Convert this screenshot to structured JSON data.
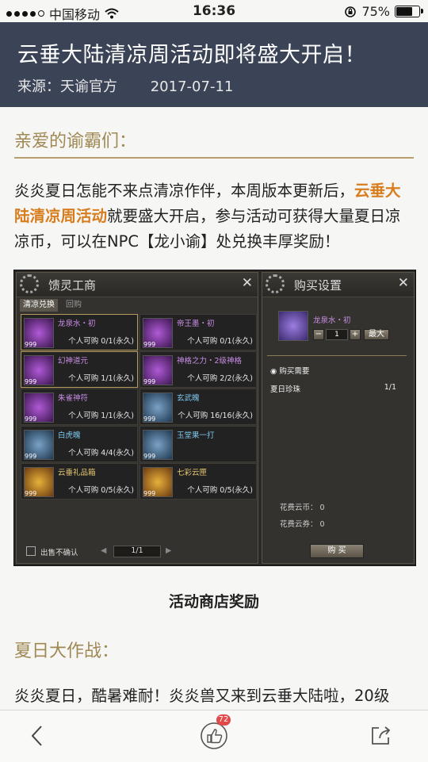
{
  "status": {
    "carrier": "中国移动",
    "time": "16:36",
    "battery": "75%",
    "battery_level": 0.75
  },
  "article": {
    "title": "云垂大陆清凉周活动即将盛大开启！",
    "source": "来源：天谕官方",
    "date": "2017-07-11"
  },
  "section1": {
    "heading": "亲爱的谕霸们：",
    "line1_a": "炎炎夏日怎能不来点清凉作伴，本周版本更新后，",
    "line1_hl": "云垂大",
    "line2_hl": "陆清凉周活动",
    "line2_b": "就要盛大开启，参与活动可获得大量夏日凉",
    "line3": "凉币，可以在NPC【龙小谕】处兑换丰厚奖励！"
  },
  "game": {
    "shop_title": "馈灵工商",
    "tab_active": "清凉兑换",
    "tab_other": "回购",
    "items": [
      {
        "name": "龙泉水・初",
        "qty": "999",
        "limit": "个人可购 0/1(永久)",
        "color": "purple",
        "icon": "dragon-water-icon"
      },
      {
        "name": "帝王墨・初",
        "qty": "999",
        "limit": "个人可购 0/1(永久)",
        "color": "purple",
        "icon": "emperor-ink-icon"
      },
      {
        "name": "幻神道元",
        "qty": "999",
        "limit": "个人可购 1/1(永久)",
        "color": "purple",
        "icon": "phantom-orb-icon"
      },
      {
        "name": "神格之力・2级神格",
        "qty": "999",
        "limit": "个人可购 2/2(永久)",
        "color": "purple",
        "icon": "divinity-gem-icon"
      },
      {
        "name": "朱雀神符",
        "qty": "999",
        "limit": "个人可购 1/1(永久)",
        "color": "purple",
        "icon": "phoenix-talisman-icon"
      },
      {
        "name": "玄武魄",
        "qty": "999",
        "limit": "个人可购 16/16(永久)",
        "color": "blue",
        "icon": "tortoise-soul-icon"
      },
      {
        "name": "白虎魄",
        "qty": "999",
        "limit": "个人可购 4/4(永久)",
        "color": "blue",
        "icon": "tiger-soul-icon"
      },
      {
        "name": "玉堂果一打",
        "qty": "999",
        "limit": "",
        "color": "blue",
        "icon": "jade-fruit-icon"
      },
      {
        "name": "云垂礼品箱",
        "qty": "999",
        "limit": "个人可购 0/5(永久)",
        "color": "yellow",
        "icon": "gift-box-icon"
      },
      {
        "name": "七彩云匣",
        "qty": "999",
        "limit": "个人可购 0/5(永久)",
        "color": "yellow",
        "icon": "treasure-chest-icon"
      }
    ],
    "checkbox_label": "出售不确认",
    "page": "1/1",
    "buy_title": "购买设置",
    "buy_item": "龙泉水・初",
    "buy_qty": "1",
    "buy_max": "最大",
    "need_label": "购买需要",
    "need_item": "夏日珍珠",
    "need_amount": "1/1",
    "cost_coin_label": "花费云币：",
    "cost_coin": "0",
    "cost_ticket_label": "花费云券：",
    "cost_ticket": "0",
    "buy_button": "购 买"
  },
  "caption": "活动商店奖励",
  "section2": {
    "heading": "夏日大作战：",
    "line1": "炎炎夏日，酷暑难耐！炎炎兽又来到云垂大陆啦，20级"
  },
  "toolbar": {
    "likes": "72"
  },
  "colors": {
    "header_bg": "#3b4457",
    "accent_gold": "#a08854",
    "highlight_orange": "#d87d1e"
  }
}
